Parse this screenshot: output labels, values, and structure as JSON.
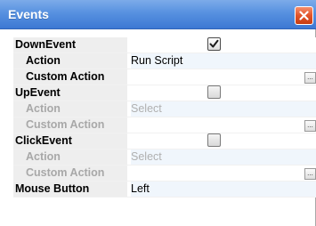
{
  "window": {
    "title": "Events"
  },
  "properties": [
    {
      "label": "DownEvent",
      "value": ""
    },
    {
      "label": "Action",
      "value": "Run Script"
    },
    {
      "label": "Custom Action",
      "value": ""
    },
    {
      "label": "UpEvent",
      "value": ""
    },
    {
      "label": "Action",
      "value": "Select"
    },
    {
      "label": "Custom Action",
      "value": ""
    },
    {
      "label": "ClickEvent",
      "value": ""
    },
    {
      "label": "Action",
      "value": "Select"
    },
    {
      "label": "Custom Action",
      "value": ""
    },
    {
      "label": "Mouse Button",
      "value": "Left"
    }
  ],
  "checkboxes": {
    "down_event": true,
    "up_event": false,
    "click_event": false
  },
  "ellipsis_label": "...",
  "colors": {
    "titlebar": "#5791e0",
    "close_button": "#e2542a",
    "label_background": "#eeeeee",
    "value_background": "#f0f6fc",
    "disabled_text": "#a8a8a8"
  },
  "icons": {
    "close": "close-icon",
    "checkmark": "checkmark-icon"
  }
}
